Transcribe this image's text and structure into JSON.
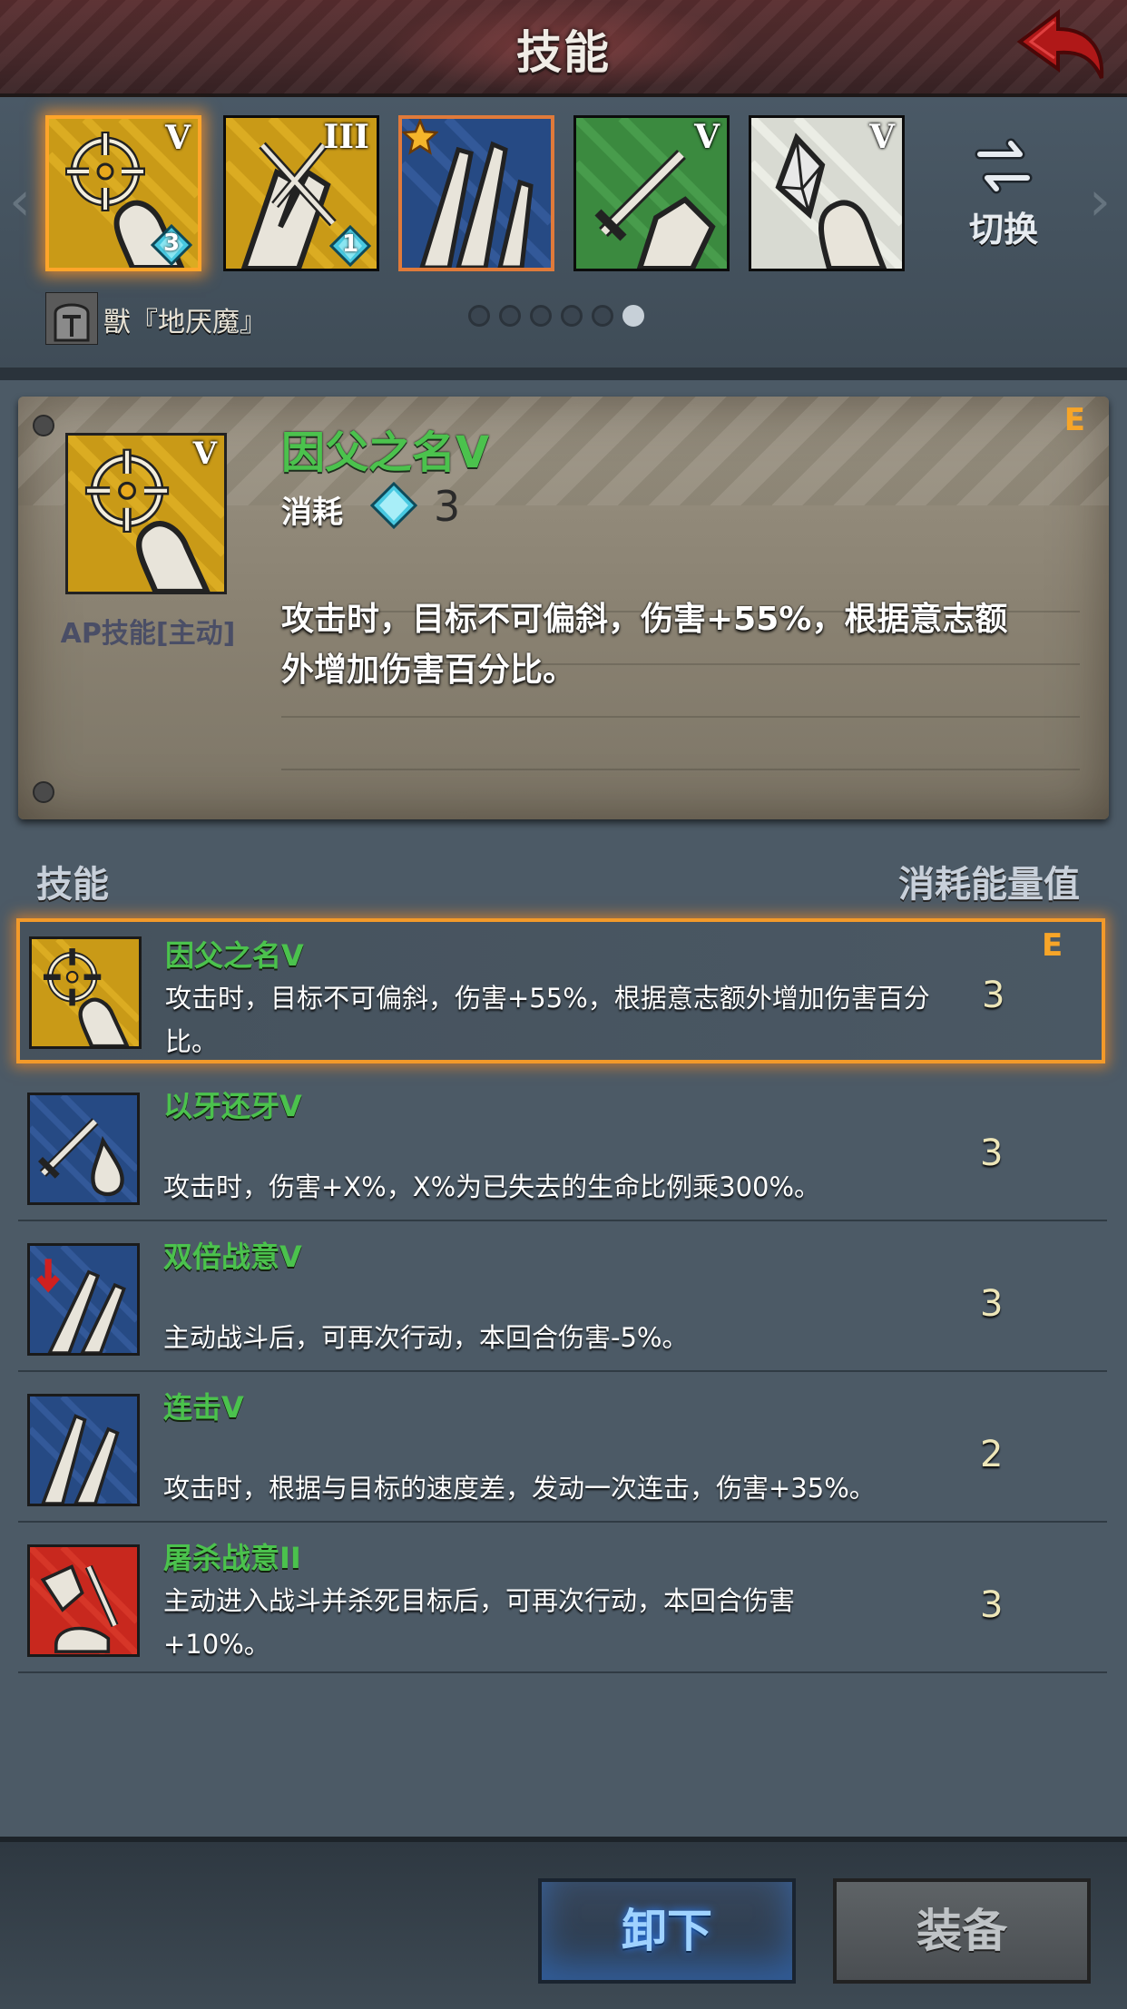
{
  "header": {
    "title": "技能"
  },
  "strip": {
    "slots": [
      {
        "tier": "V",
        "gem": "3"
      },
      {
        "tier": "III",
        "gem": "1"
      },
      {
        "tier": "",
        "gem": ""
      },
      {
        "tier": "V",
        "gem": ""
      },
      {
        "tier": "V",
        "gem": ""
      }
    ],
    "switch_label": "切换",
    "owner": "獸『地厌魔』"
  },
  "detail": {
    "name": "因父之名V",
    "cost_label": "消耗",
    "cost_value": "3",
    "type": "AP技能[主动]",
    "grade": "E",
    "description": "攻击时，目标不可偏斜，伤害+55%，根据意志额外增加伤害百分比。"
  },
  "list": {
    "header_skill": "技能",
    "header_cost": "消耗能量值",
    "rows": [
      {
        "name": "因父之名V",
        "desc": "攻击时，目标不可偏斜，伤害+55%，根据意志额外增加伤害百分比。",
        "cost": "3",
        "grade": "E"
      },
      {
        "name": "以牙还牙V",
        "desc": "攻击时，伤害+X%，X%为已失去的生命比例乘300%。",
        "cost": "3"
      },
      {
        "name": "双倍战意V",
        "desc": "主动战斗后，可再次行动，本回合伤害-5%。",
        "cost": "3"
      },
      {
        "name": "连击V",
        "desc": "攻击时，根据与目标的速度差，发动一次连击，伤害+35%。",
        "cost": "2"
      },
      {
        "name": "屠杀战意II",
        "desc": "主动进入战斗并杀死目标后，可再次行动，本回合伤害+10%。",
        "cost": "3"
      }
    ]
  },
  "footer": {
    "unequip_label": "卸下",
    "equip_label": "装备"
  },
  "colors": {
    "accent": "#ffa52a",
    "skill_name": "#4bc24d",
    "grade": "#f7a528"
  }
}
